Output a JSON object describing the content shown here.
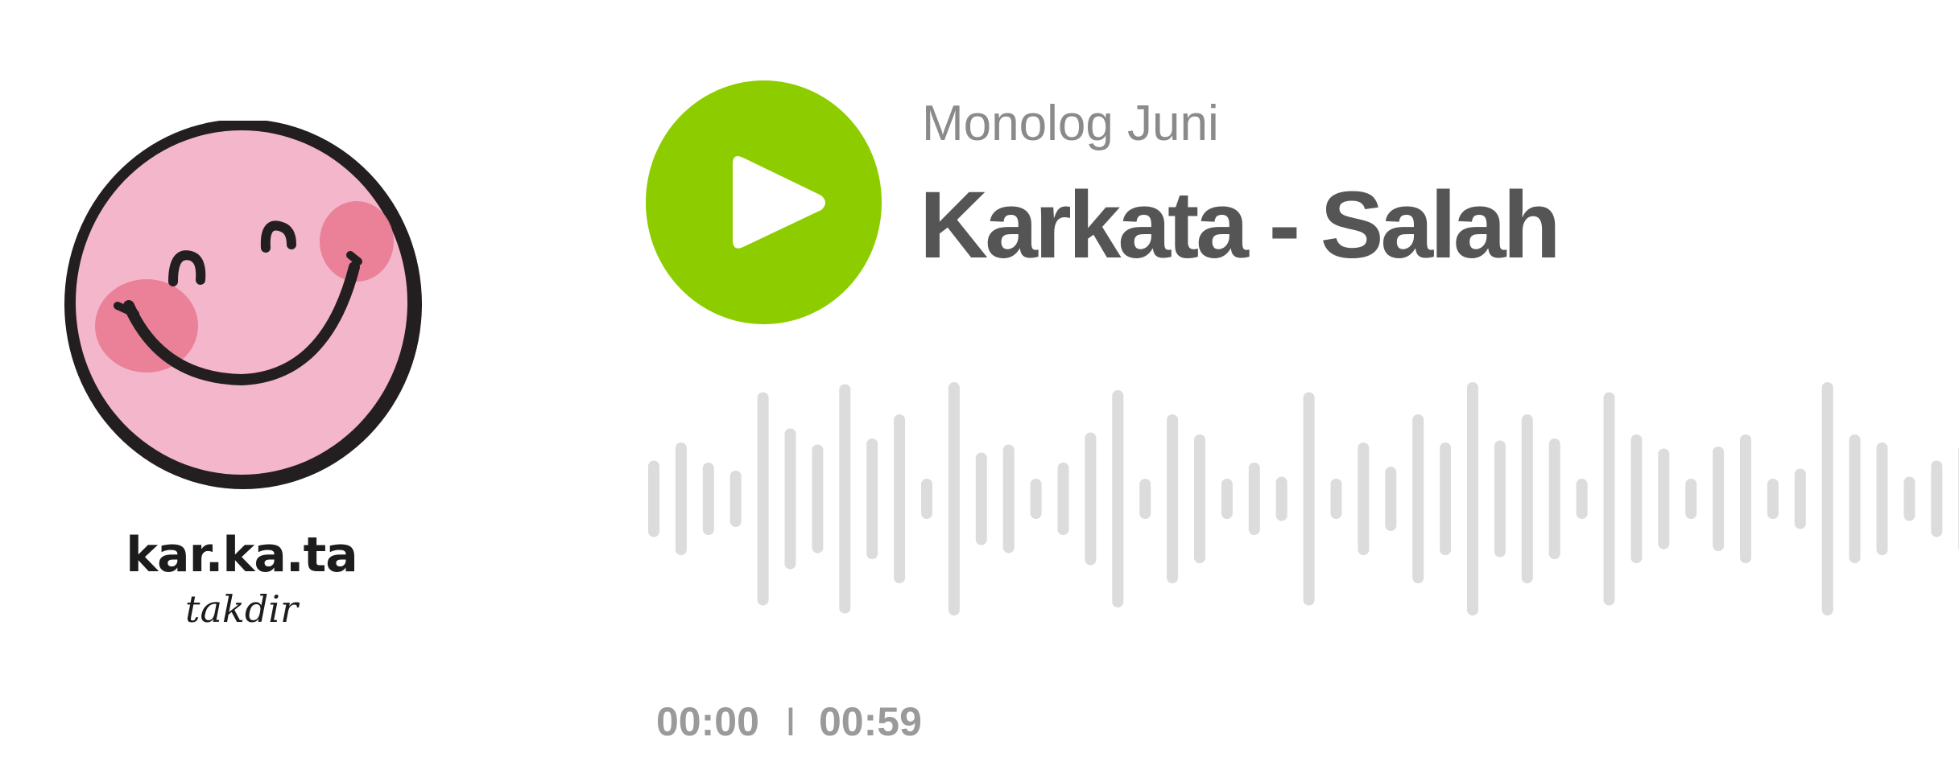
{
  "artwork": {
    "brand": "kar.ka.ta",
    "sub": "takdir"
  },
  "track": {
    "album": "Monolog Juni",
    "title": "Karkata - Salah"
  },
  "player": {
    "current_time": "00:00",
    "separator": "I",
    "duration": "00:59",
    "progress": 0,
    "play_icon": "play-icon"
  },
  "colors": {
    "accent": "#8dcd00",
    "waveform": "#dcdcdc",
    "title": "#555555",
    "album": "#8a8a8a",
    "time": "#9a9a9a",
    "face": "#f4b6cb",
    "cheek": "#e8788f",
    "ink": "#231f20"
  }
}
